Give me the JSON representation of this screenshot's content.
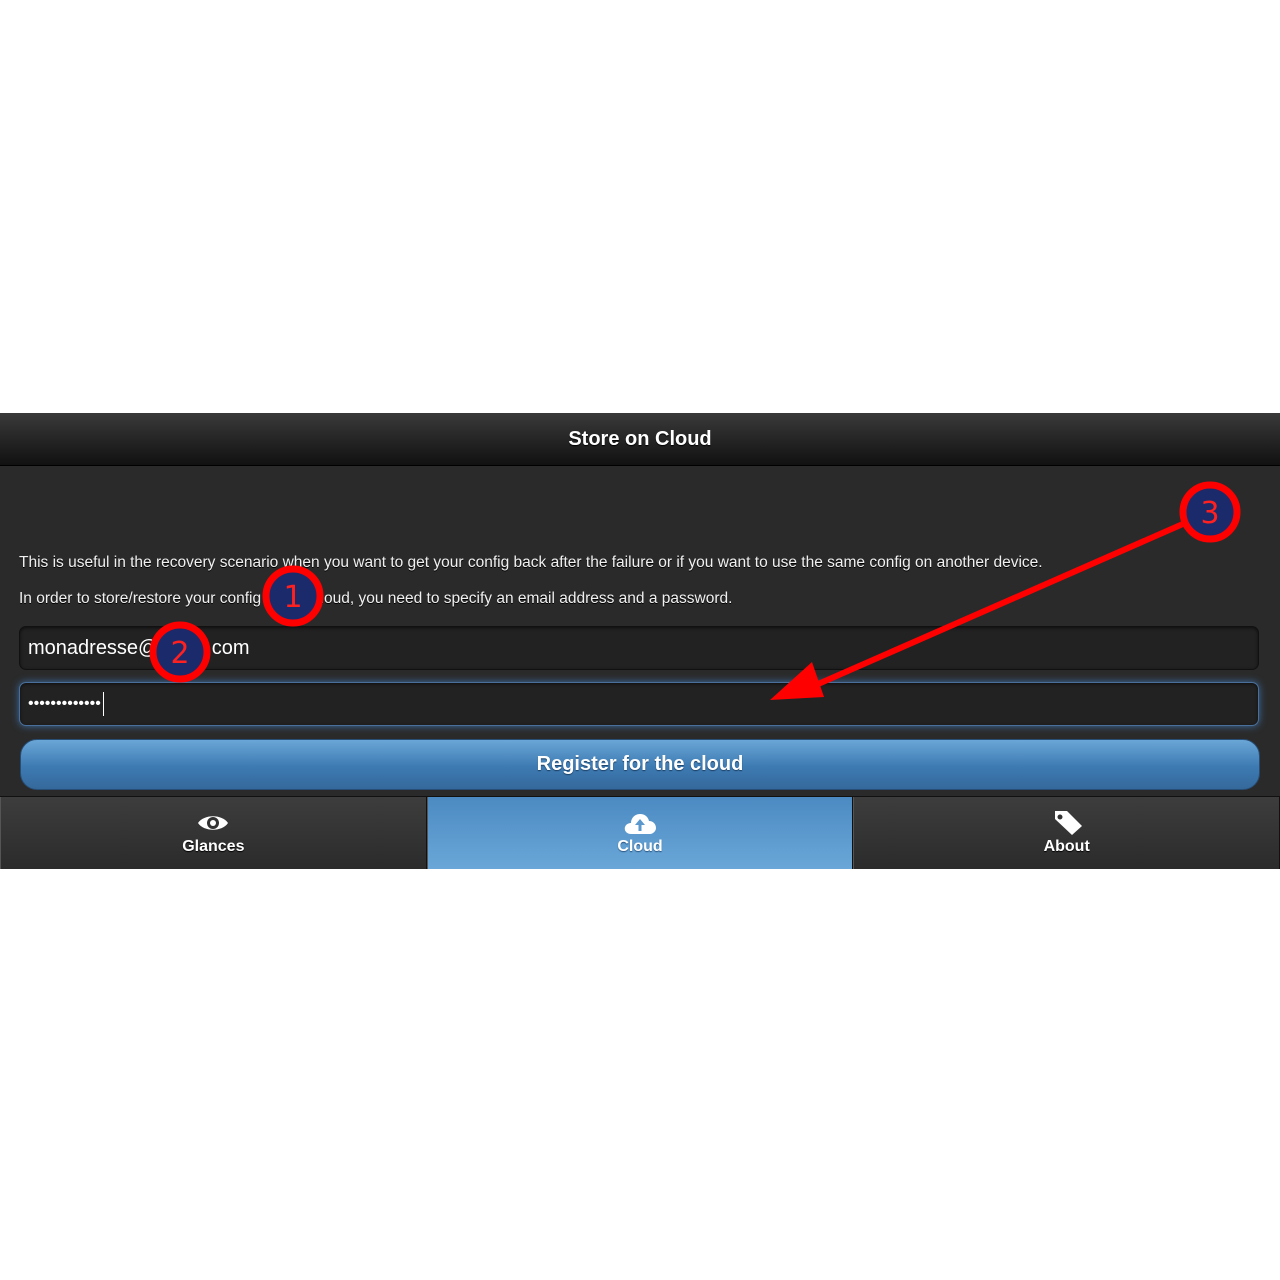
{
  "header": {
    "title": "Store on Cloud"
  },
  "content": {
    "paragraph_1": "This is useful in the recovery scenario when you want to get your config back after the failure or if you want to use the same config on another device.",
    "paragraph_2": "In order to store/restore your config on the cloud, you need to specify an email address and a password.",
    "email_value": "monadresse@gmail.com",
    "password_value": "•••••••••••••",
    "register_label": "Register for the cloud"
  },
  "navbar": {
    "tabs": [
      {
        "label": "Glances",
        "icon": "eye-icon",
        "active": false
      },
      {
        "label": "Cloud",
        "icon": "cloud-upload-icon",
        "active": true
      },
      {
        "label": "About",
        "icon": "tag-icon",
        "active": false
      }
    ]
  },
  "annotations": {
    "markers": [
      "1",
      "2",
      "3"
    ],
    "marker_color": "#ff0000",
    "marker_fill": "#1b2a6b",
    "arrow_color": "#ff0000"
  },
  "colors": {
    "accent": "#4a8cc4",
    "background": "#2a2a2a"
  }
}
